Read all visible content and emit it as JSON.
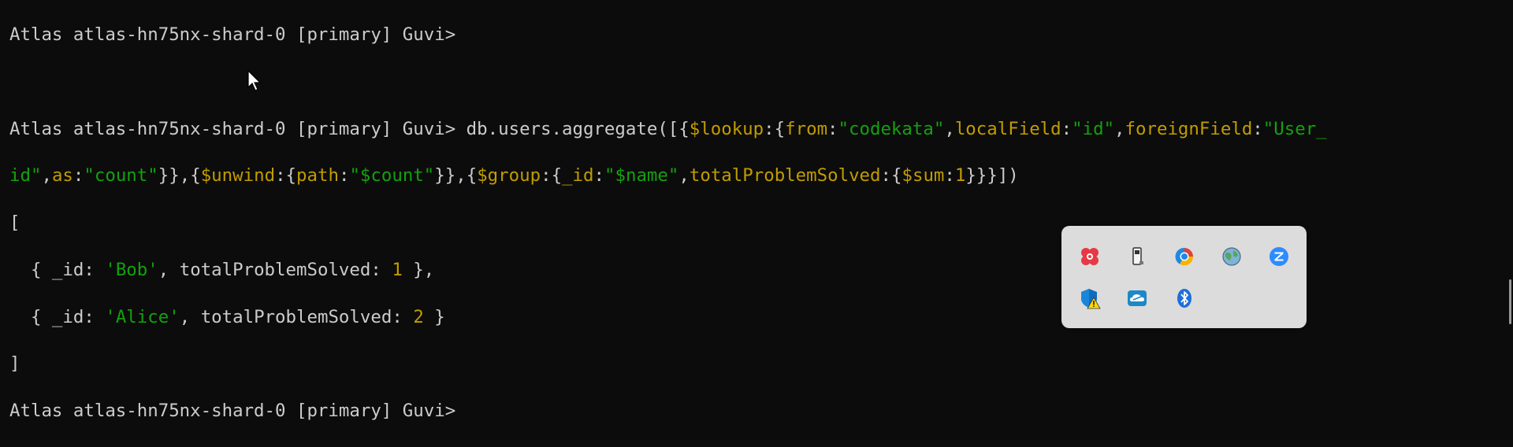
{
  "terminal": {
    "prompt": "Atlas atlas-hn75nx-shard-0 [primary] Guvi>",
    "command_name": "db.users.aggregate",
    "command_open": "([{",
    "lookup": "$lookup",
    "from_key": "from",
    "from_val": "\"codekata\"",
    "localField_key": "localField",
    "localField_val": "\"id\"",
    "foreignField_key": "foreignField",
    "foreignField_val": "\"User_",
    "foreignField_val_cont": "id\"",
    "as_key": "as",
    "as_val": "\"count\"",
    "unwind": "$unwind",
    "path_key": "path",
    "path_val": "\"$count\"",
    "group": "$group",
    "id_key": "_id",
    "id_val": "\"$name\"",
    "total_key": "totalProblemSolved",
    "sum_key": "$sum",
    "sum_val": "1",
    "open_bracket": "[",
    "close_bracket": "]",
    "result_key_id": "_id",
    "result_key_total": "totalProblemSolved",
    "results": [
      {
        "id": "'Bob'",
        "total": "1"
      },
      {
        "id": "'Alice'",
        "total": "2"
      }
    ]
  },
  "tray": {
    "icons": [
      "app-flower-icon",
      "usb-drive-icon",
      "browser-icon",
      "network-globe-icon",
      "zoom-icon",
      "security-warning-icon",
      "cloud-sync-icon",
      "bluetooth-icon"
    ]
  },
  "colors": {
    "background": "#0c0c0c",
    "text": "#cccccc",
    "keyword": "#c19c00",
    "string": "#13a10e"
  }
}
